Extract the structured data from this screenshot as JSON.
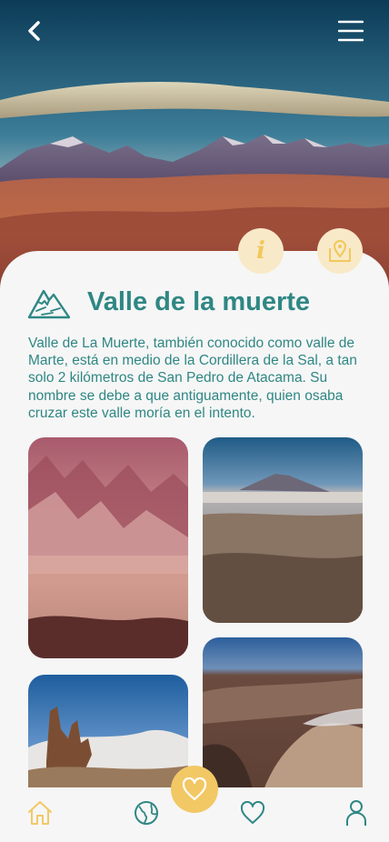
{
  "header": {
    "back_icon": "chevron-left-icon",
    "menu_icon": "hamburger-menu-icon"
  },
  "actions": {
    "info_label": "i",
    "map_icon": "map-pin-icon"
  },
  "place": {
    "icon": "mountain-icon",
    "title": "Valle de la muerte",
    "description": "Valle de La Muerte, también conocido como valle de Marte, está en medio de la Cordillera de la Sal, a tan solo 2 kilómetros de San Pedro de Atacama. Su nombre se debe a que antiguamente, quien osaba cruzar este valle moría en el intento."
  },
  "gallery": {
    "photos": [
      "desert-ridges-photo",
      "desert-volcano-photo",
      "rock-formation-photo",
      "canyon-valley-photo"
    ]
  },
  "nav": {
    "items": [
      "home-icon",
      "globe-icon",
      "favorites-icon",
      "profile-icon"
    ],
    "center_button_icon": "heart-icon"
  },
  "colors": {
    "accent": "#2f8784",
    "highlight": "#f2c865",
    "soft_highlight": "#f8e9c8",
    "background": "#f6f6f6"
  }
}
